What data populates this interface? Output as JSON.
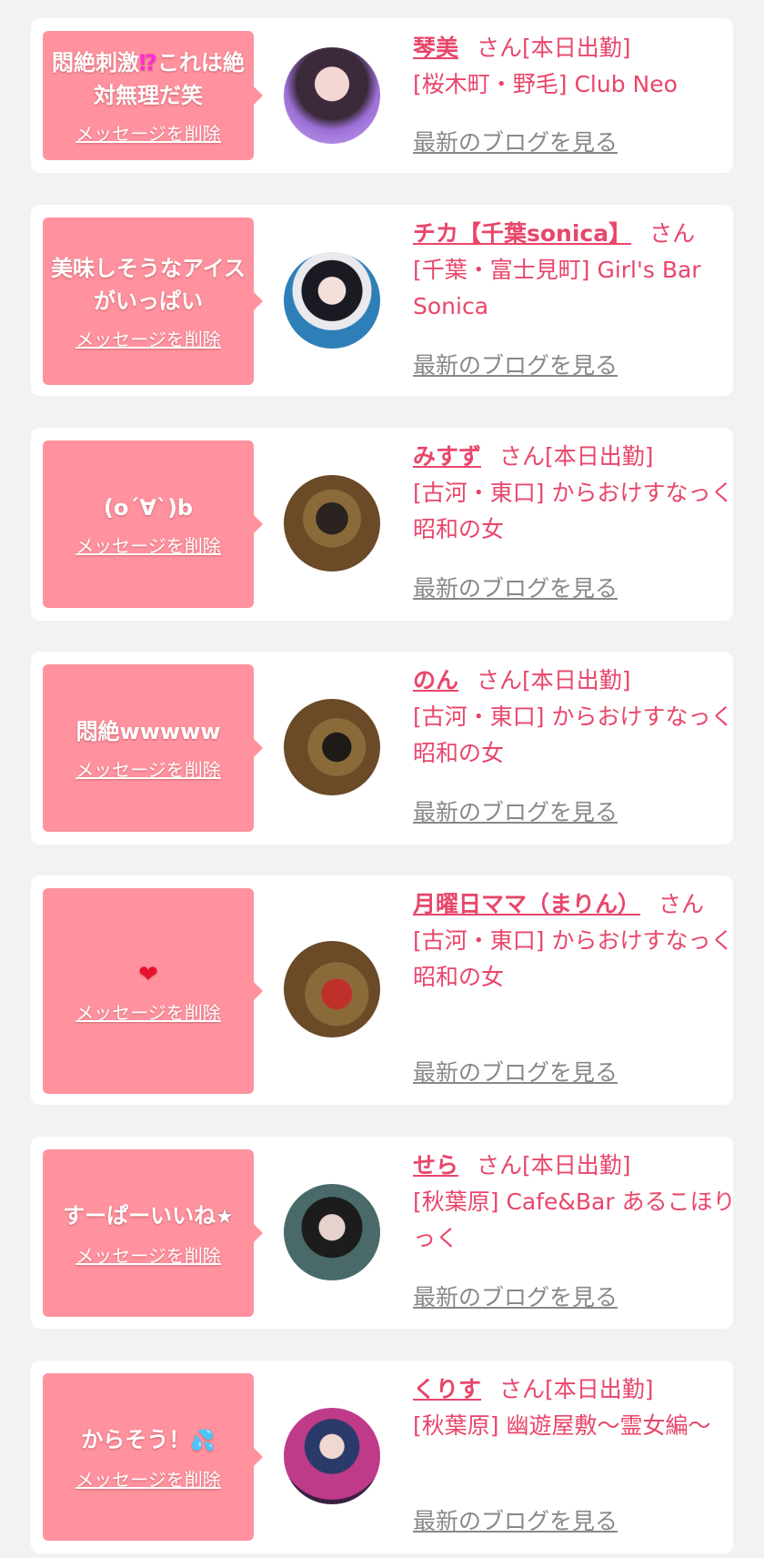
{
  "items": [
    {
      "message": "悶絶刺激⁉️これは絶対無理だ笑",
      "message_main": "悶絶刺激",
      "message_mark": "⁉",
      "message_rest": "これは絶対無理だ笑",
      "delete_label": "メッセージを削除",
      "name": "琴美",
      "suffix": "さん[本日出勤]",
      "shop": "[桜木町・野毛] Club Neo",
      "blog_label": "最新のブログを見る"
    },
    {
      "message": "美味しそうなアイスがいっぱい",
      "delete_label": "メッセージを削除",
      "name": "チカ【千葉sonica】",
      "suffix": "さん",
      "shop": "[千葉・富士見町] Girl's Bar Sonica",
      "blog_label": "最新のブログを見る"
    },
    {
      "message": "(o´∀`)b",
      "delete_label": "メッセージを削除",
      "name": "みすず",
      "suffix": "さん[本日出勤]",
      "shop": "[古河・東口] からおけすなっく 昭和の女",
      "blog_label": "最新のブログを見る"
    },
    {
      "message": "悶絶wwwww",
      "delete_label": "メッセージを削除",
      "name": "のん",
      "suffix": "さん[本日出勤]",
      "shop": "[古河・東口] からおけすなっく 昭和の女",
      "blog_label": "最新のブログを見る"
    },
    {
      "message_icon": "heart-arrow-icon",
      "delete_label": "メッセージを削除",
      "name": "月曜日ママ（まりん）",
      "suffix": "さん",
      "shop": "[古河・東口] からおけすなっく 昭和の女",
      "blog_label": "最新のブログを見る"
    },
    {
      "message": "すーぱーいいね",
      "message_icon": "star-icon",
      "delete_label": "メッセージを削除",
      "name": "せら",
      "suffix": "さん[本日出勤]",
      "shop": "[秋葉原] Cafe&Bar あるこほりっく",
      "blog_label": "最新のブログを見る"
    },
    {
      "message": "からそう！",
      "message_icon": "sweat-drop-icon",
      "delete_label": "メッセージを削除",
      "name": "くりす",
      "suffix": "さん[本日出勤]",
      "shop": "[秋葉原] 幽遊屋敷～霊女編～",
      "blog_label": "最新のブログを見る"
    }
  ],
  "colors": {
    "page_bg": "#f2f2f2",
    "card_bg": "#ffffff",
    "bubble_bg": "#ff929e",
    "accent_text": "#e8466a",
    "blog_link": "#888888"
  }
}
